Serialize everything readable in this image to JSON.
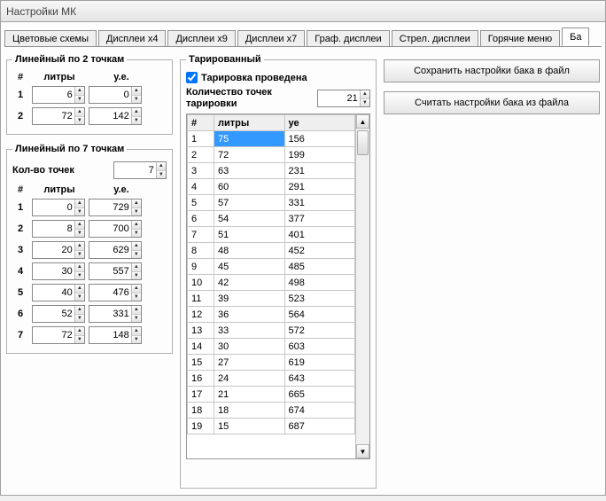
{
  "window": {
    "title": "Настройки МК"
  },
  "tabs": {
    "items": [
      "Цветовые схемы",
      "Дисплеи x4",
      "Дисплеи x9",
      "Дисплеи x7",
      "Граф. дисплеи",
      "Стрел. дисплеи",
      "Горячие меню",
      "Ба"
    ],
    "active": 7
  },
  "linear2": {
    "legend": "Линейный по 2 точкам",
    "col_num": "#",
    "col_l": "литры",
    "col_u": "у.е.",
    "rows": [
      {
        "n": "1",
        "l": "6",
        "u": "0"
      },
      {
        "n": "2",
        "l": "72",
        "u": "142"
      }
    ]
  },
  "linear7": {
    "legend": "Линейный по 7 точкам",
    "points_label": "Кол-во точек",
    "points_value": "7",
    "col_num": "#",
    "col_l": "литры",
    "col_u": "у.е.",
    "rows": [
      {
        "n": "1",
        "l": "0",
        "u": "729"
      },
      {
        "n": "2",
        "l": "8",
        "u": "700"
      },
      {
        "n": "3",
        "l": "20",
        "u": "629"
      },
      {
        "n": "4",
        "l": "30",
        "u": "557"
      },
      {
        "n": "5",
        "l": "40",
        "u": "476"
      },
      {
        "n": "6",
        "l": "52",
        "u": "331"
      },
      {
        "n": "7",
        "l": "72",
        "u": "148"
      }
    ]
  },
  "tare": {
    "legend": "Тарированный",
    "check_label": "Тарировка проведена",
    "checked": true,
    "count_label": "Количество точек тарировки",
    "count_value": "21",
    "cols": {
      "n": "#",
      "l": "литры",
      "u": "уе"
    },
    "rows": [
      {
        "n": "1",
        "l": "75",
        "u": "156"
      },
      {
        "n": "2",
        "l": "72",
        "u": "199"
      },
      {
        "n": "3",
        "l": "63",
        "u": "231"
      },
      {
        "n": "4",
        "l": "60",
        "u": "291"
      },
      {
        "n": "5",
        "l": "57",
        "u": "331"
      },
      {
        "n": "6",
        "l": "54",
        "u": "377"
      },
      {
        "n": "7",
        "l": "51",
        "u": "401"
      },
      {
        "n": "8",
        "l": "48",
        "u": "452"
      },
      {
        "n": "9",
        "l": "45",
        "u": "485"
      },
      {
        "n": "10",
        "l": "42",
        "u": "498"
      },
      {
        "n": "11",
        "l": "39",
        "u": "523"
      },
      {
        "n": "12",
        "l": "36",
        "u": "564"
      },
      {
        "n": "13",
        "l": "33",
        "u": "572"
      },
      {
        "n": "14",
        "l": "30",
        "u": "603"
      },
      {
        "n": "15",
        "l": "27",
        "u": "619"
      },
      {
        "n": "16",
        "l": "24",
        "u": "643"
      },
      {
        "n": "17",
        "l": "21",
        "u": "665"
      },
      {
        "n": "18",
        "l": "18",
        "u": "674"
      },
      {
        "n": "19",
        "l": "15",
        "u": "687"
      }
    ]
  },
  "buttons": {
    "save": "Сохранить настройки бака в файл",
    "load": "Считать настройки бака из файла"
  }
}
